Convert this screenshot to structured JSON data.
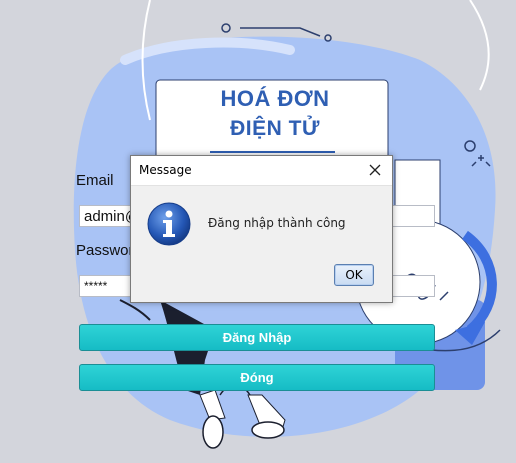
{
  "banner": {
    "line1": "HOÁ ĐƠN",
    "line2": "ĐIỆN TỬ"
  },
  "form": {
    "email_label": "Email",
    "email_value": "admin@",
    "password_label": "Password",
    "password_value": "*****"
  },
  "buttons": {
    "login": "Đăng Nhập",
    "close": "Đóng"
  },
  "dialog": {
    "title": "Message",
    "message": "Đăng nhập thành công",
    "ok": "OK"
  },
  "colors": {
    "background": "#d3d5dc",
    "button_teal": "#1cc6ce",
    "banner_text": "#2f5fb3",
    "illustration_blue": "#a9c3f5"
  }
}
